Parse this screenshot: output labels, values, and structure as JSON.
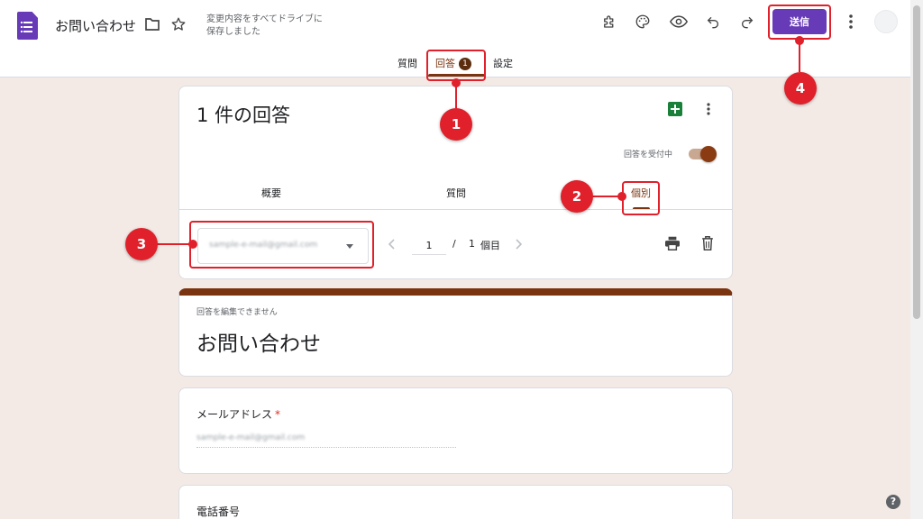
{
  "header": {
    "title": "お問い合わせ",
    "save_status_line1": "変更内容をすべてドライブに",
    "save_status_line2": "保存しました",
    "send_label": "送信"
  },
  "tabs": [
    {
      "label": "質問"
    },
    {
      "label": "回答",
      "badge": "1",
      "active": true
    },
    {
      "label": "設定"
    }
  ],
  "summary": {
    "title": "1 件の回答",
    "accepting_label": "回答を受付中",
    "accepting": true,
    "subtabs": [
      {
        "label": "概要"
      },
      {
        "label": "質問"
      },
      {
        "label": "個別",
        "active": true
      }
    ],
    "pager": {
      "current": "1",
      "separator": "/",
      "total": "1",
      "unit": "個目"
    }
  },
  "form": {
    "readonly_note": "回答を編集できません",
    "title": "お問い合わせ",
    "questions": [
      {
        "label": "メールアドレス",
        "required_mark": "*"
      },
      {
        "label": "電話番号"
      }
    ]
  },
  "annotations": [
    "1",
    "2",
    "3",
    "4"
  ],
  "colors": {
    "brand": "#673ab7",
    "accent": "#7b3410",
    "background": "#f3eae6",
    "annotation": "#e0202a"
  }
}
